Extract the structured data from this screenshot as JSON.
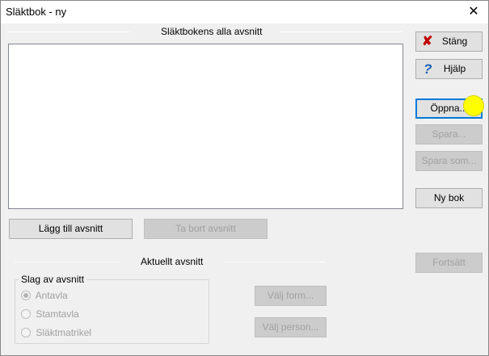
{
  "window": {
    "title": "Släktbok - ny",
    "close_glyph": "✕"
  },
  "sections_group": {
    "title": "Släktbokens alla avsnitt"
  },
  "sidebar": {
    "close_label": "Stäng",
    "help_label": "Hjälp",
    "open_label": "Öppna...",
    "save_label": "Spara...",
    "save_as_label": "Spara som...",
    "new_book_label": "Ny bok",
    "continue_label": "Fortsätt"
  },
  "actions": {
    "add_label": "Lägg till avsnitt",
    "remove_label": "Ta bort avsnitt"
  },
  "current_section": {
    "title": "Aktuellt avsnitt",
    "type_group_title": "Slag av avsnitt",
    "options": [
      {
        "label": "Antavla",
        "checked": true
      },
      {
        "label": "Stamtavla",
        "checked": false
      },
      {
        "label": "Släktmatrikel",
        "checked": false
      }
    ],
    "choose_form_label": "Välj form...",
    "choose_person_label": "Välj person..."
  },
  "icons": {
    "close_icon": "red-x-icon",
    "help_icon": "blue-question-icon"
  }
}
